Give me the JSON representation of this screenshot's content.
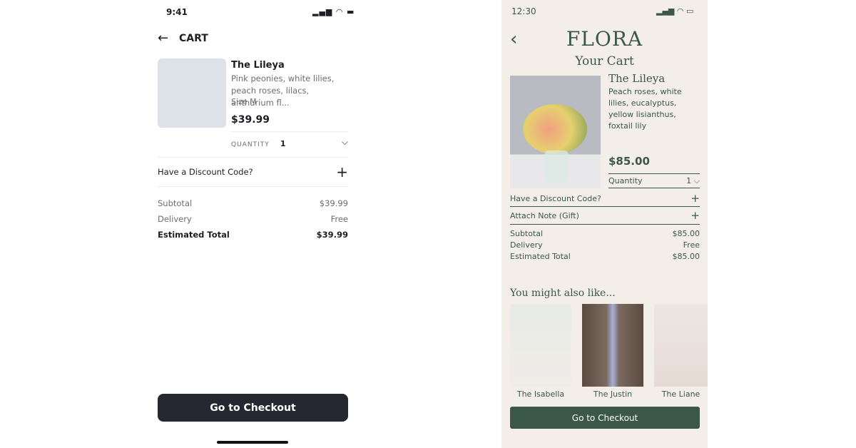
{
  "left": {
    "status_time": "9:41",
    "title": "CART",
    "product": {
      "name": "The Lileya",
      "description": "Pink peonies, white lilies, peach roses, lilacs, anthurium fl...",
      "size": "Size M",
      "price": "$39.99",
      "quantity_label": "QUANTITY",
      "quantity": "1"
    },
    "discount_label": "Have a Discount Code?",
    "summary": [
      {
        "label": "Subtotal",
        "value": "$39.99"
      },
      {
        "label": "Delivery",
        "value": "Free"
      },
      {
        "label": "Estimated Total",
        "value": "$39.99"
      }
    ],
    "checkout_label": "Go to Checkout"
  },
  "right": {
    "status_time": "12:30",
    "logo": "FLORA",
    "title": "Your Cart",
    "product": {
      "name": "The Lileya",
      "description": "Peach roses, white lilies, eucalyptus, yellow lisianthus, foxtail lily",
      "price": "$85.00",
      "quantity_label": "Quantity",
      "quantity": "1"
    },
    "discount_label": "Have a Discount Code?",
    "note_label": "Attach Note (Gift)",
    "summary": [
      {
        "label": "Subtotal",
        "value": "$85.00"
      },
      {
        "label": "Delivery",
        "value": "Free"
      },
      {
        "label": "Estimated Total",
        "value": "$85.00"
      }
    ],
    "suggest_title": "You might also like...",
    "suggestions": [
      {
        "name": "The Isabella"
      },
      {
        "name": "The Justin"
      },
      {
        "name": "The Liane"
      }
    ],
    "checkout_label": "Go to Checkout",
    "accent": "#3b5847",
    "background": "#f4eee8"
  }
}
